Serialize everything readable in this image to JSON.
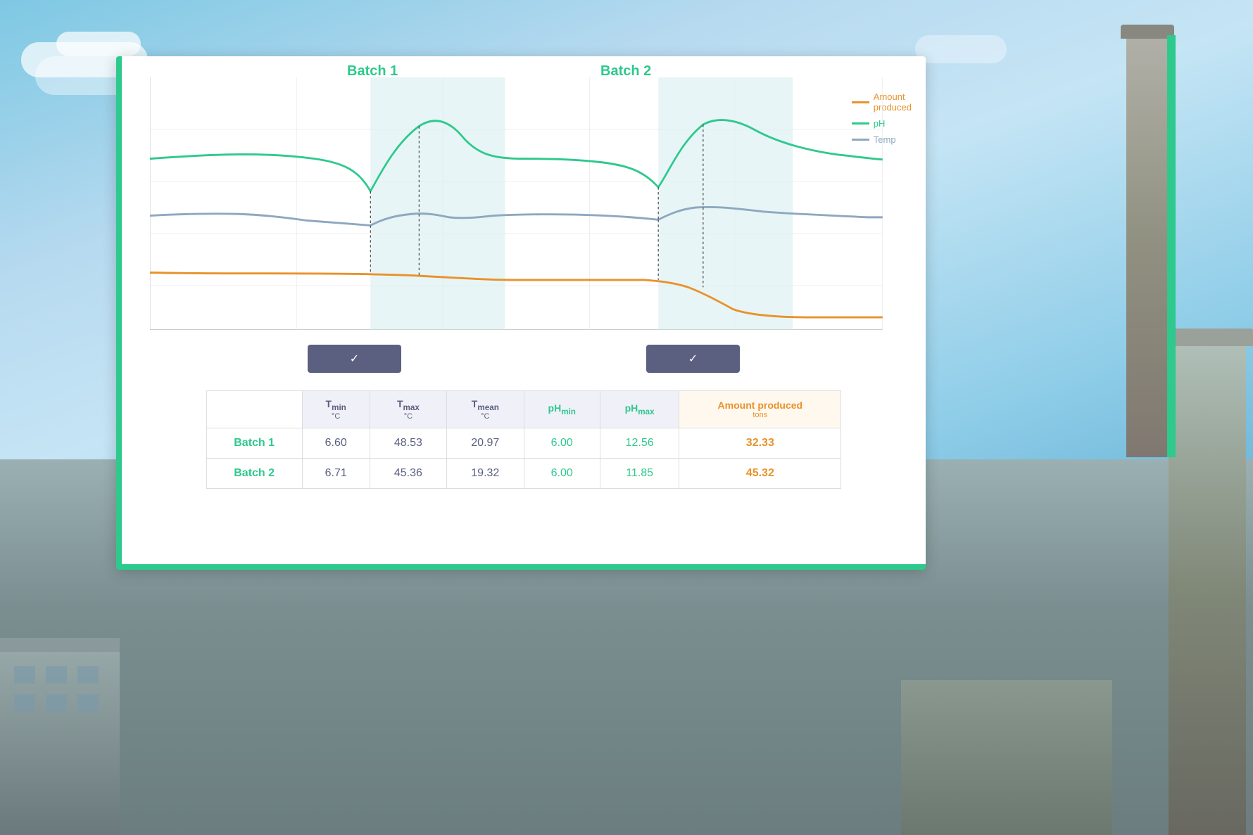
{
  "background": {
    "sky_color": "#87ceeb",
    "ground_color": "#8a9090"
  },
  "chart": {
    "batch1_label": "Batch 1",
    "batch2_label": "Batch 2",
    "check_button_label": "✓",
    "legend": [
      {
        "name": "Amount produced",
        "color": "#e8922a"
      },
      {
        "name": "pH",
        "color": "#2ec98d"
      },
      {
        "name": "Temp",
        "color": "#8ea8c0"
      }
    ]
  },
  "table": {
    "headers": [
      {
        "key": "batch",
        "label": ""
      },
      {
        "key": "tmin",
        "label": "T",
        "sub": "min",
        "unit": "°C"
      },
      {
        "key": "tmax",
        "label": "T",
        "sub": "max",
        "unit": "°C"
      },
      {
        "key": "tmean",
        "label": "T",
        "sub": "mean",
        "unit": "°C"
      },
      {
        "key": "phmin",
        "label": "pH",
        "sub": "min",
        "unit": ""
      },
      {
        "key": "phmax",
        "label": "pH",
        "sub": "max",
        "unit": ""
      },
      {
        "key": "amount",
        "label": "Amount produced",
        "sub": "",
        "unit": "tons"
      }
    ],
    "rows": [
      {
        "batch": "Batch 1",
        "tmin": "6.60",
        "tmax": "48.53",
        "tmean": "20.97",
        "phmin": "6.00",
        "phmax": "12.56",
        "amount": "32.33"
      },
      {
        "batch": "Batch 2",
        "tmin": "6.71",
        "tmax": "45.36",
        "tmean": "19.32",
        "phmin": "6.00",
        "phmax": "11.85",
        "amount": "45.32"
      }
    ]
  }
}
